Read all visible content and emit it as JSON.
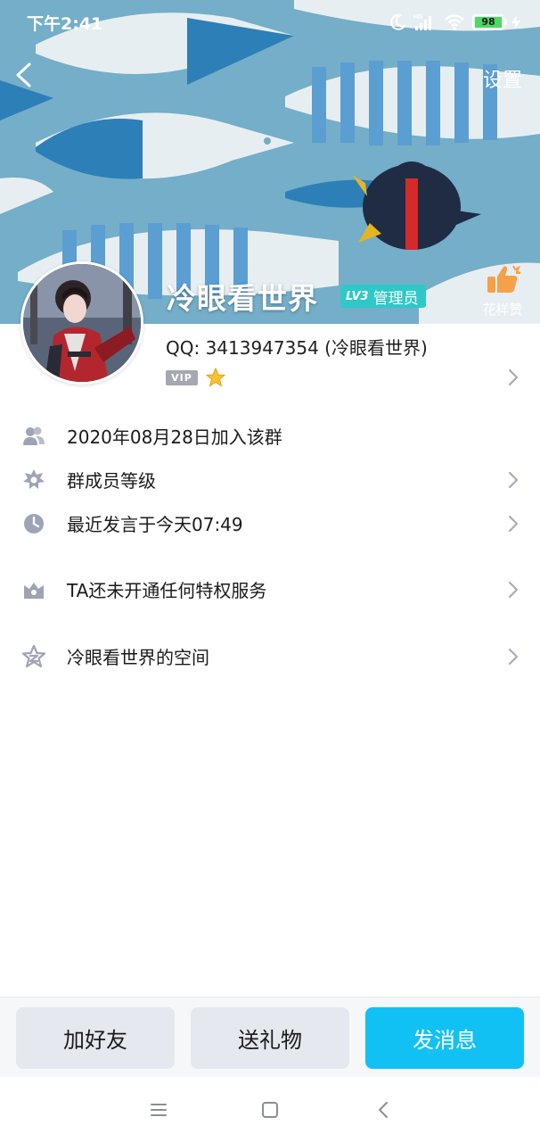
{
  "status_bar": {
    "time": "下午2:41",
    "network_label": "HD",
    "battery_level": "98",
    "icons": [
      "moon-icon",
      "signal-icon",
      "wifi-icon",
      "battery-icon",
      "charging-icon"
    ]
  },
  "header": {
    "back_icon": "chevron-left-icon",
    "settings_label": "设置",
    "like_label": "花样赞",
    "like_icon": "thumbs-up-icon"
  },
  "profile": {
    "nickname": "冷眼看世界",
    "level": "LV3",
    "role": "管理员",
    "qq_line": "QQ: 3413947354 (冷眼看世界)",
    "vip_label": "VIP",
    "star_icon": "star-icon"
  },
  "info_rows": [
    {
      "icon": "members-icon",
      "label": "2020年08月28日加入该群",
      "has_chevron": false
    },
    {
      "icon": "level-gear-icon",
      "label": "群成员等级",
      "has_chevron": true
    },
    {
      "icon": "clock-icon",
      "label": "最近发言于今天07:49",
      "has_chevron": true
    },
    {
      "icon": "privilege-crown-icon",
      "label": "TA还未开通任何特权服务",
      "has_chevron": true
    },
    {
      "icon": "qzone-star-icon",
      "label": "冷眼看世界的空间",
      "has_chevron": true
    }
  ],
  "actions": {
    "add_friend": "加好友",
    "send_gift": "送礼物",
    "send_message": "发消息"
  },
  "nav": [
    "menu-icon",
    "home-square-icon",
    "back-triangle-icon"
  ],
  "colors": {
    "cover_blue": "#74aec8",
    "accent": "#12c1f3",
    "level_badge": "#2ec8c8",
    "icon_gray": "#9ea3b5"
  }
}
